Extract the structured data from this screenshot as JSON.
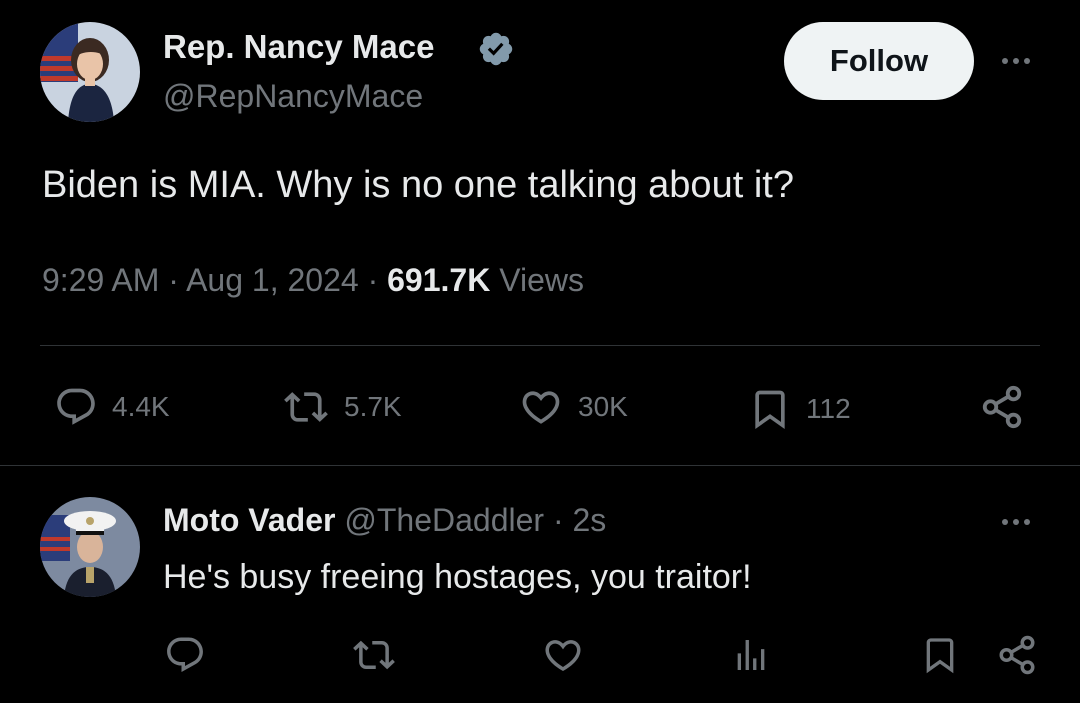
{
  "tweet": {
    "author_name": "Rep. Nancy Mace",
    "author_handle": "@RepNancyMace",
    "follow_label": "Follow",
    "text": "Biden is MIA. Why is no one talking about it?",
    "time": "9:29 AM",
    "separator": "·",
    "date": "Aug 1, 2024",
    "views_count": "691.7K",
    "views_label": "Views",
    "stats": {
      "replies": "4.4K",
      "reposts": "5.7K",
      "likes": "30K",
      "bookmarks": "112"
    }
  },
  "reply": {
    "author_name": "Moto Vader",
    "author_handle": "@TheDaddler",
    "separator": "·",
    "time_ago": "2s",
    "text": "He's busy freeing hostages, you traitor!"
  },
  "colors": {
    "background": "#000000",
    "text": "#e7e9ea",
    "muted": "#71767b",
    "verified": "#829aab",
    "follow_bg": "#eff3f4",
    "divider": "#2f3336"
  },
  "icons": {
    "verified": "verified-badge-icon",
    "more": "more-icon",
    "reply": "reply-icon",
    "repost": "repost-icon",
    "like": "like-icon",
    "bookmark": "bookmark-icon",
    "share": "share-icon",
    "analytics": "analytics-icon"
  }
}
